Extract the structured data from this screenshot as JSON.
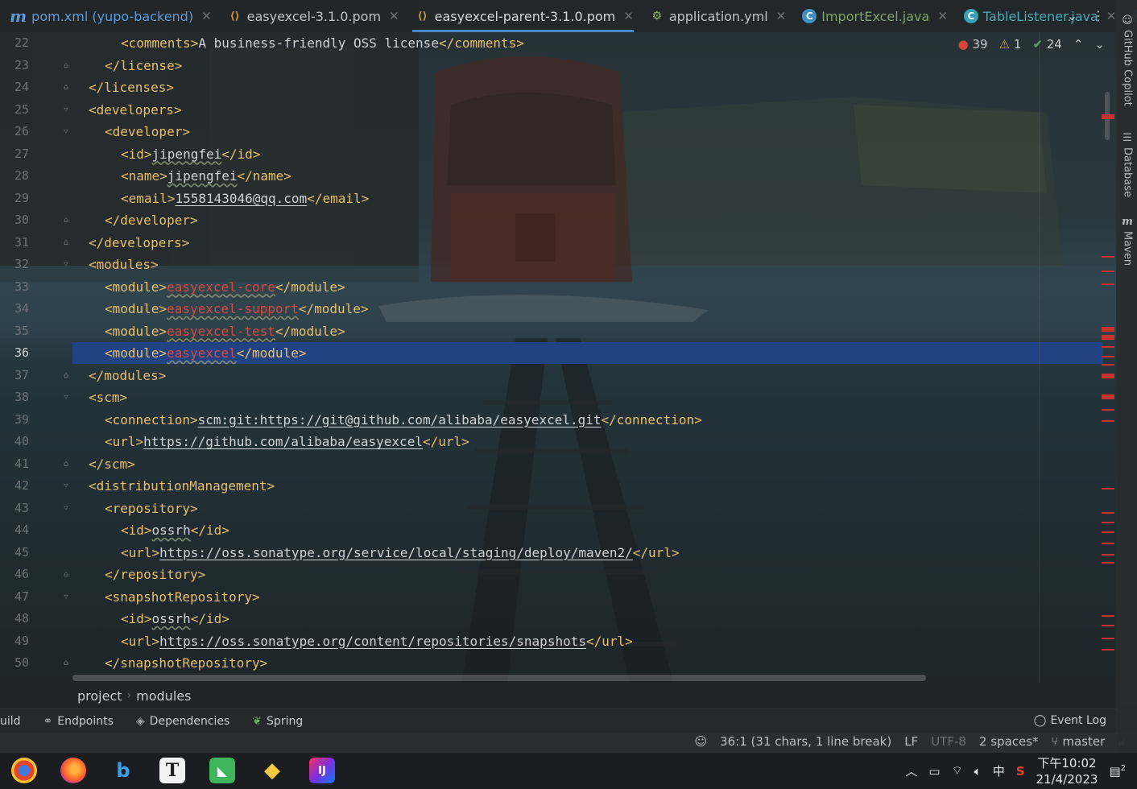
{
  "tabs": [
    {
      "label": "pom.xml (yupo-backend)",
      "icon": "maven-icon",
      "state": "normal"
    },
    {
      "label": "easyexcel-3.1.0.pom",
      "icon": "xml-file-icon",
      "state": "normal"
    },
    {
      "label": "easyexcel-parent-3.1.0.pom",
      "icon": "xml-file-icon",
      "state": "active"
    },
    {
      "label": "application.yml",
      "icon": "yaml-file-icon",
      "state": "normal"
    },
    {
      "label": "ImportExcel.java",
      "icon": "java-class-icon",
      "state": "error"
    },
    {
      "label": "TableListener.java",
      "icon": "java-class-icon",
      "state": "error2"
    }
  ],
  "inspection": {
    "errors": "39",
    "warnings": "1",
    "ok": "24"
  },
  "editor": {
    "current_line": "36",
    "lines": [
      {
        "n": "22",
        "indent": 3,
        "parts": [
          [
            "tag",
            "<comments>"
          ],
          [
            "text",
            "A business-friendly OSS license"
          ],
          [
            "tag",
            "</comments>"
          ]
        ]
      },
      {
        "n": "23",
        "indent": 2,
        "fold": true,
        "parts": [
          [
            "tag",
            "</license>"
          ]
        ]
      },
      {
        "n": "24",
        "indent": 1,
        "fold": true,
        "parts": [
          [
            "tag",
            "</licenses>"
          ]
        ]
      },
      {
        "n": "25",
        "indent": 1,
        "fold": true,
        "parts": [
          [
            "tag",
            "<developers>"
          ]
        ]
      },
      {
        "n": "26",
        "indent": 2,
        "fold": true,
        "parts": [
          [
            "tag",
            "<developer>"
          ]
        ]
      },
      {
        "n": "27",
        "indent": 3,
        "parts": [
          [
            "tag",
            "<id>"
          ],
          [
            "spell",
            "jipengfei"
          ],
          [
            "tag",
            "</id>"
          ]
        ]
      },
      {
        "n": "28",
        "indent": 3,
        "parts": [
          [
            "tag",
            "<name>"
          ],
          [
            "spell",
            "jipengfei"
          ],
          [
            "tag",
            "</name>"
          ]
        ]
      },
      {
        "n": "29",
        "indent": 3,
        "parts": [
          [
            "tag",
            "<email>"
          ],
          [
            "link",
            "1558143046@qq.com"
          ],
          [
            "tag",
            "</email>"
          ]
        ]
      },
      {
        "n": "30",
        "indent": 2,
        "fold": true,
        "parts": [
          [
            "tag",
            "</developer>"
          ]
        ]
      },
      {
        "n": "31",
        "indent": 1,
        "fold": true,
        "parts": [
          [
            "tag",
            "</developers>"
          ]
        ]
      },
      {
        "n": "32",
        "indent": 1,
        "fold": true,
        "parts": [
          [
            "tag",
            "<modules>"
          ]
        ]
      },
      {
        "n": "33",
        "indent": 2,
        "parts": [
          [
            "tag",
            "<module>"
          ],
          [
            "red",
            "easyexcel-core"
          ],
          [
            "tag",
            "</module>"
          ]
        ]
      },
      {
        "n": "34",
        "indent": 2,
        "parts": [
          [
            "tag",
            "<module>"
          ],
          [
            "red",
            "easyexcel-support"
          ],
          [
            "tag",
            "</module>"
          ]
        ]
      },
      {
        "n": "35",
        "indent": 2,
        "parts": [
          [
            "tag",
            "<module>"
          ],
          [
            "red",
            "easyexcel-test"
          ],
          [
            "tag",
            "</module>"
          ]
        ]
      },
      {
        "n": "36",
        "indent": 2,
        "highlight": true,
        "parts": [
          [
            "tag",
            "<module>"
          ],
          [
            "red",
            "easyexcel"
          ],
          [
            "tag",
            "</module>"
          ]
        ]
      },
      {
        "n": "37",
        "indent": 1,
        "fold": true,
        "parts": [
          [
            "tag",
            "</modules>"
          ]
        ]
      },
      {
        "n": "38",
        "indent": 1,
        "fold": true,
        "parts": [
          [
            "tag",
            "<scm>"
          ]
        ]
      },
      {
        "n": "39",
        "indent": 2,
        "parts": [
          [
            "tag",
            "<connection>"
          ],
          [
            "link",
            "scm:git:https://git@github.com/alibaba/easyexcel.git"
          ],
          [
            "tag",
            "</connection>"
          ]
        ]
      },
      {
        "n": "40",
        "indent": 2,
        "parts": [
          [
            "tag",
            "<url>"
          ],
          [
            "link",
            "https://github.com/alibaba/easyexcel"
          ],
          [
            "tag",
            "</url>"
          ]
        ]
      },
      {
        "n": "41",
        "indent": 1,
        "fold": true,
        "parts": [
          [
            "tag",
            "</scm>"
          ]
        ]
      },
      {
        "n": "42",
        "indent": 1,
        "fold": true,
        "parts": [
          [
            "tag",
            "<distributionManagement>"
          ]
        ]
      },
      {
        "n": "43",
        "indent": 2,
        "fold": true,
        "parts": [
          [
            "tag",
            "<repository>"
          ]
        ]
      },
      {
        "n": "44",
        "indent": 3,
        "parts": [
          [
            "tag",
            "<id>"
          ],
          [
            "spell",
            "ossrh"
          ],
          [
            "tag",
            "</id>"
          ]
        ]
      },
      {
        "n": "45",
        "indent": 3,
        "parts": [
          [
            "tag",
            "<url>"
          ],
          [
            "link",
            "https://oss.sonatype.org/service/local/staging/deploy/maven2/"
          ],
          [
            "tag",
            "</url>"
          ]
        ]
      },
      {
        "n": "46",
        "indent": 2,
        "fold": true,
        "parts": [
          [
            "tag",
            "</repository>"
          ]
        ]
      },
      {
        "n": "47",
        "indent": 2,
        "fold": true,
        "parts": [
          [
            "tag",
            "<snapshotRepository>"
          ]
        ]
      },
      {
        "n": "48",
        "indent": 3,
        "parts": [
          [
            "tag",
            "<id>"
          ],
          [
            "spell",
            "ossrh"
          ],
          [
            "tag",
            "</id>"
          ]
        ]
      },
      {
        "n": "49",
        "indent": 3,
        "parts": [
          [
            "tag",
            "<url>"
          ],
          [
            "link",
            "https://oss.sonatype.org/content/repositories/snapshots"
          ],
          [
            "tag",
            "</url>"
          ]
        ]
      },
      {
        "n": "50",
        "indent": 2,
        "fold": true,
        "parts": [
          [
            "tag",
            "</snapshotRepository>"
          ]
        ]
      }
    ]
  },
  "breadcrumb": [
    "project",
    "modules"
  ],
  "tool_windows": [
    {
      "label": "uild",
      "icon": "build-icon"
    },
    {
      "label": "Endpoints",
      "icon": "endpoints-icon"
    },
    {
      "label": "Dependencies",
      "icon": "dependencies-icon"
    },
    {
      "label": "Spring",
      "icon": "spring-icon"
    }
  ],
  "event_log": "Event Log",
  "right_tools": [
    {
      "label": "GitHub Copilot",
      "icon": "copilot-icon"
    },
    {
      "label": "Database",
      "icon": "database-icon"
    },
    {
      "label": "Maven",
      "icon": "maven-icon"
    }
  ],
  "status": {
    "position": "36:1 (31 chars, 1 line break)",
    "line_sep": "LF",
    "encoding": "UTF-8",
    "indent": "2 spaces*",
    "branch": "master"
  },
  "taskbar": {
    "apps": [
      "chrome-icon",
      "firefox-icon",
      "bing-icon",
      "typora-icon",
      "app-green-icon",
      "git-icon",
      "intellij-icon"
    ],
    "time": "下午10:02",
    "date": "21/4/2023",
    "ime": "中",
    "notifications": "2"
  },
  "colors": {
    "accent": "#4b86c6",
    "selection": "#214283",
    "error": "#d9443a",
    "tag": "#e8bf6a"
  }
}
